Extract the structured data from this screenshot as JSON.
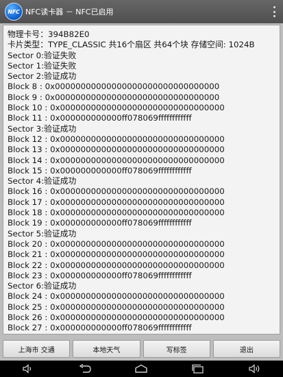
{
  "window": {
    "title": "NFC读卡器 － NFC已启用",
    "icon_text": "NFC"
  },
  "content_lines": [
    "物理卡号：394B82E0",
    "卡片类型：TYPE_CLASSIC  共16个扇区 共64个块  存储空间: 1024B",
    "Sector 0:验证失败",
    "Sector 1:验证失败",
    "Sector 2:验证成功",
    "Block 8 : 0x00000000000000000000000000000000",
    "Block 9 : 0x00000000000000000000000000000000",
    "Block 10 : 0x00000000000000000000000000000000",
    "Block 11 : 0x000000000000ff078069ffffffffffff",
    "Sector 3:验证成功",
    "Block 12 : 0x00000000000000000000000000000000",
    "Block 13 : 0x00000000000000000000000000000000",
    "Block 14 : 0x00000000000000000000000000000000",
    "Block 15 : 0x000000000000ff078069ffffffffffff",
    "Sector 4:验证成功",
    "Block 16 : 0x00000000000000000000000000000000",
    "Block 17 : 0x00000000000000000000000000000000",
    "Block 18 : 0x00000000000000000000000000000000",
    "Block 19 : 0x000000000000ff078069ffffffffffff",
    "Sector 5:验证成功",
    "Block 20 : 0x00000000000000000000000000000000",
    "Block 21 : 0x00000000000000000000000000000000",
    "Block 22 : 0x00000000000000000000000000000000",
    "Block 23 : 0x000000000000ff078069ffffffffffff",
    "Sector 6:验证成功",
    "Block 24 : 0x00000000000000000000000000000000",
    "Block 25 : 0x00000000000000000000000000000000",
    "Block 26 : 0x00000000000000000000000000000000",
    "Block 27 : 0x000000000000ff078069ffffffffffff"
  ],
  "buttons": {
    "shanghai_transit": "上海市 交通",
    "local_weather": "本地天气",
    "write_tag": "写标签",
    "exit": "退出"
  },
  "icons": {
    "app": "nfc-logo-icon",
    "overflow": "overflow-menu-icon",
    "volume_down": "volume-down-icon",
    "back": "back-icon",
    "home": "home-icon",
    "recents": "recent-apps-icon",
    "volume_up": "volume-up-icon"
  },
  "colors": {
    "titlebar": "#555555",
    "content_bg": "#f3f3f3",
    "navbar": "#000000"
  }
}
